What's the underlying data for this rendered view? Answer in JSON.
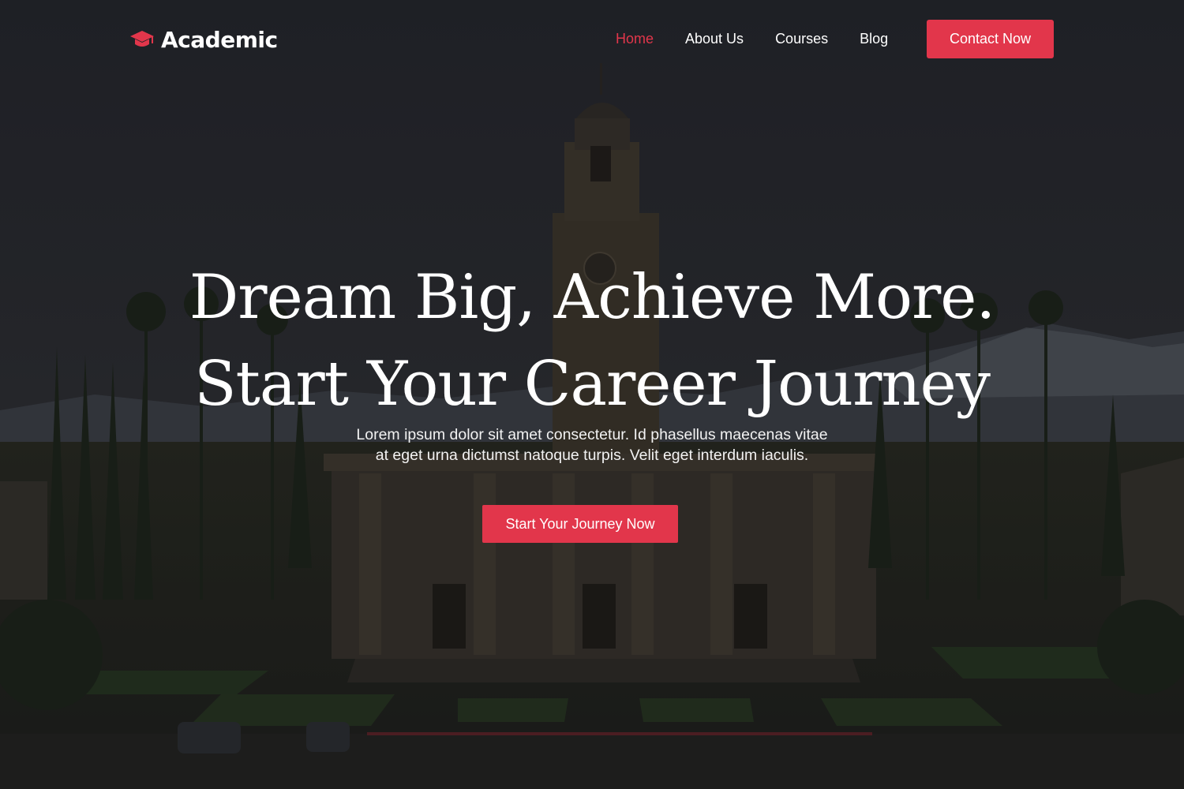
{
  "brand": {
    "name": "Academic",
    "logo_icon": "graduation-cap-icon",
    "accent_color": "#e2364b"
  },
  "nav": {
    "items": [
      {
        "label": "Home",
        "active": true
      },
      {
        "label": "About Us",
        "active": false
      },
      {
        "label": "Courses",
        "active": false
      },
      {
        "label": "Blog",
        "active": false
      }
    ],
    "contact_label": "Contact Now"
  },
  "hero": {
    "headline_line1": "Dream Big, Achieve More.",
    "headline_line2": "Start Your Career Journey",
    "subtext_line1": "Lorem ipsum dolor sit amet consectetur. Id phasellus maecenas vitae",
    "subtext_line2": "at eget urna dictumst natoque turpis. Velit eget interdum iaculis.",
    "cta_label": "Start Your Journey Now",
    "background": "campus-clock-tower-photo"
  }
}
